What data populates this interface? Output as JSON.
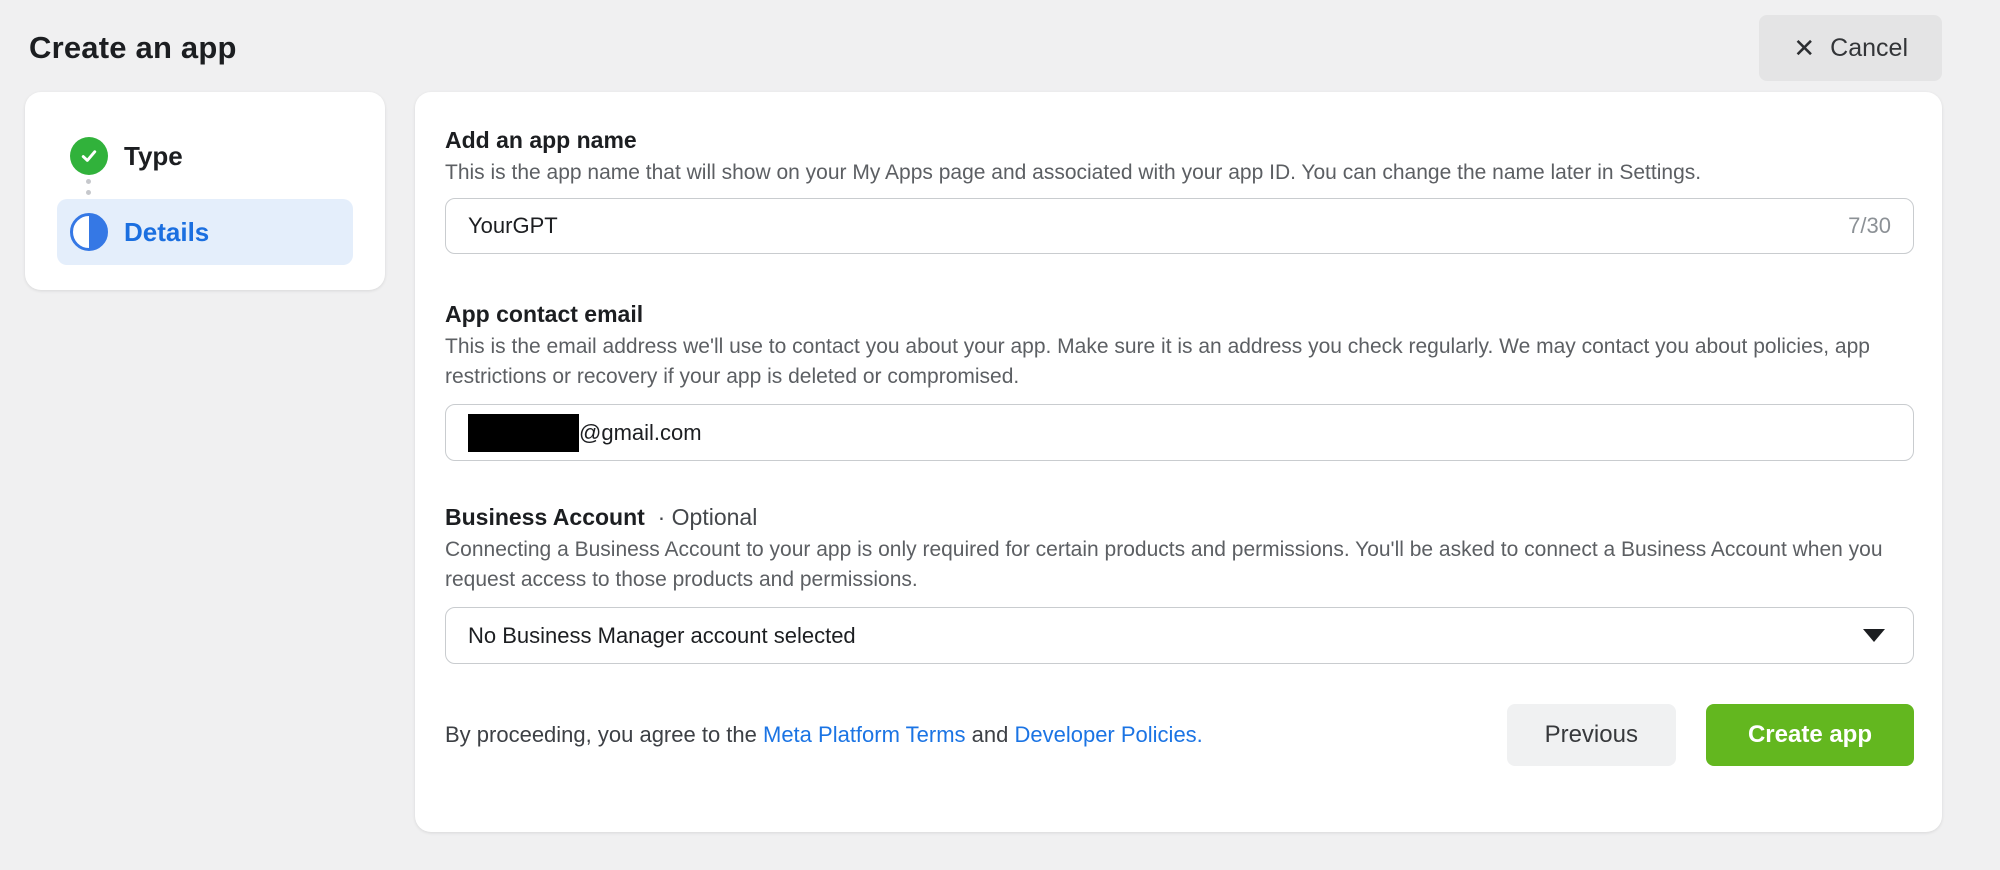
{
  "header": {
    "title": "Create an app",
    "cancel_label": "Cancel",
    "close_icon": "✕"
  },
  "stepper": {
    "steps": [
      {
        "label": "Type",
        "state": "complete",
        "icon": "check-circle-icon"
      },
      {
        "label": "Details",
        "state": "active",
        "icon": "half-circle-icon"
      }
    ]
  },
  "form": {
    "app_name": {
      "label": "Add an app name",
      "description": "This is the app name that will show on your My Apps page and associated with your app ID. You can change the name later in Settings.",
      "value": "YourGPT",
      "counter": "7/30"
    },
    "contact_email": {
      "label": "App contact email",
      "description": "This is the email address we'll use to contact you about your app. Make sure it is an address you check regularly. We may contact you about policies, app restrictions or recovery if your app is deleted or compromised.",
      "visible_value": "@gmail.com",
      "redacted": true
    },
    "business_account": {
      "label": "Business Account",
      "label_suffix": "· Optional",
      "description": "Connecting a Business Account to your app is only required for certain products and permissions. You'll be asked to connect a Business Account when you request access to those products and permissions.",
      "selected_value": "No Business Manager account selected"
    },
    "footer": {
      "agreement_prefix": "By proceeding, you agree to the ",
      "terms_link": "Meta Platform Terms",
      "agreement_middle": " and ",
      "policies_link": "Developer Policies.",
      "previous_label": "Previous",
      "create_label": "Create app"
    }
  },
  "colors": {
    "page_background": "#f0f0f1",
    "accent_blue": "#1b74e4",
    "step_active_background": "#e4eefb",
    "success_green": "#31b23b",
    "create_button_green": "#63b71f",
    "input_border": "#c9cccf",
    "helper_text": "#5c5f63"
  }
}
